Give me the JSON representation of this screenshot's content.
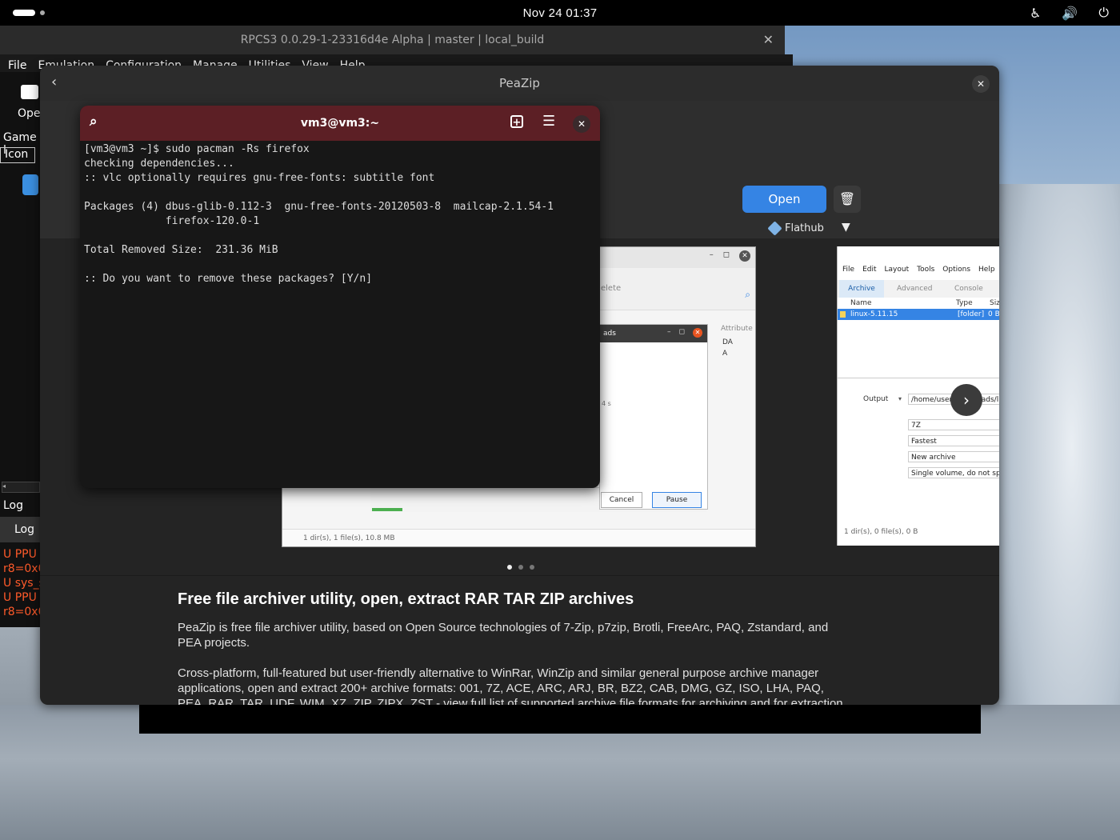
{
  "topbar": {
    "clock": "Nov 24  01:37",
    "icons": [
      "accessibility-icon",
      "volume-icon",
      "power-icon"
    ]
  },
  "rpcs3": {
    "title": "RPCS3 0.0.29-1-23316d4e Alpha | master | local_build",
    "menu": [
      "File",
      "Emulation",
      "Configuration",
      "Manage",
      "Utilities",
      "View",
      "Help"
    ],
    "open_label": "Ope",
    "game_label": "Game l",
    "icon_label": "Icon",
    "log_header": "Log",
    "log_tab": "Log",
    "log_lines": [
      "U PPU",
      "r8=0x0",
      "U sys_s",
      "U PPU",
      "r8=0x0"
    ]
  },
  "software": {
    "title": "PeaZip",
    "open_button": "Open",
    "source": "Flathub",
    "colors": {
      "accent": "#3584e4",
      "header": "#2c2c2c"
    },
    "screenshot1": {
      "delete_label": "elete",
      "attr_header": "Attribute",
      "attr_values": [
        "DA",
        "A"
      ],
      "dialog_title": "ads",
      "dialog_side": "4 s",
      "cancel": "Cancel",
      "pause": "Pause",
      "status": "1 dir(s), 1 file(s), 10.8 MB"
    },
    "screenshot2": {
      "menu": [
        "File",
        "Edit",
        "Layout",
        "Tools",
        "Options",
        "Help"
      ],
      "tabs": [
        "Archive",
        "Advanced",
        "Console"
      ],
      "col_name": "Name",
      "col_type": "Type",
      "col_size": "Siz",
      "row_name": "linux-5.11.15",
      "row_type": "[folder]",
      "row_size": "0 B",
      "output_label": "Output",
      "output_path": "/home/user/Downloads/l",
      "format": "7Z",
      "level": "Fastest",
      "archive_name": "New archive",
      "volume": "Single volume, do not spl",
      "status": "1 dir(s), 0 file(s), 0 B"
    },
    "description": {
      "heading": "Free file archiver utility, open, extract RAR TAR ZIP archives",
      "p1": "PeaZip is free file archiver utility, based on Open Source technologies of 7-Zip, p7zip, Brotli, FreeArc, PAQ, Zstandard, and PEA projects.",
      "p2": "Cross-platform, full-featured but user-friendly alternative to WinRar, WinZip and similar general purpose archive manager applications, open and extract 200+ archive formats: 001, 7Z, ACE, ARC, ARJ, BR, BZ2, CAB, DMG, GZ, ISO, LHA, PAQ, PEA, RAR, TAR, UDF, WIM, XZ, ZIP, ZIPX, ZST - view full list of supported archive file formats for archiving and for extraction."
    }
  },
  "terminal": {
    "title": "vm3@vm3:~",
    "output": "[vm3@vm3 ~]$ sudo pacman -Rs firefox\nchecking dependencies...\n:: vlc optionally requires gnu-free-fonts: subtitle font\n\nPackages (4) dbus-glib-0.112-3  gnu-free-fonts-20120503-8  mailcap-2.1.54-1\n             firefox-120.0-1\n\nTotal Removed Size:  231.36 MiB\n\n:: Do you want to remove these packages? [Y/n]"
  }
}
